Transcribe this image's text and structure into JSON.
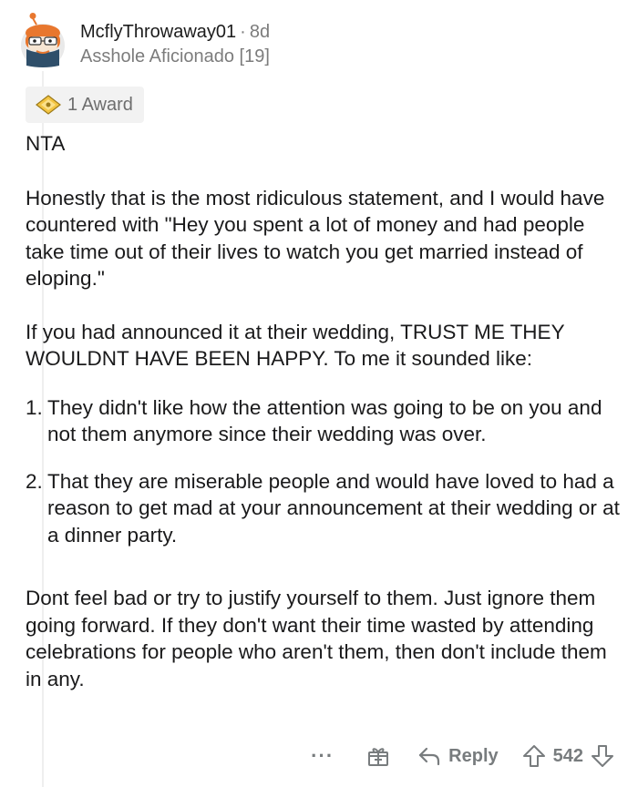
{
  "comment": {
    "username": "McflyThrowaway01",
    "separator": "·",
    "age": "8d",
    "flair": "Asshole Aficionado [19]",
    "award_label": "1 Award",
    "body": {
      "verdict": "NTA",
      "paragraph1": "Honestly that is the most ridiculous statement, and I would have countered with \"Hey you spent a lot of money and had people take time out of their lives to watch you get married instead of eloping.\"",
      "paragraph2": "If you had announced it at their wedding, TRUST ME THEY WOULDNT HAVE BEEN HAPPY.  To me it sounded like:",
      "list": [
        {
          "number": "1.",
          "text": "They didn't like how the attention was going to be on you and not them anymore since their wedding was over."
        },
        {
          "number": "2.",
          "text": "That they are miserable people and would have loved to had a reason to get mad at your announcement at their wedding or at a dinner party."
        }
      ],
      "paragraph3": "Dont feel bad or try to justify yourself to them.  Just ignore them going forward.  If they don't want their time wasted by attending celebrations for people who aren't them, then don't include them in any."
    },
    "actions": {
      "more_label": "···",
      "reply_label": "Reply",
      "score": "542"
    }
  },
  "icons": {
    "avatar": "snoo-avatar-icon",
    "award": "award-icon",
    "gift": "gift-icon",
    "reply": "reply-arrow-icon",
    "upvote": "upvote-arrow-icon",
    "downvote": "downvote-arrow-icon"
  },
  "colors": {
    "text": "#1a1a1b",
    "muted": "#7c7c7c",
    "award_bg": "#f2f2f2",
    "avatar_orange": "#e8772e"
  }
}
